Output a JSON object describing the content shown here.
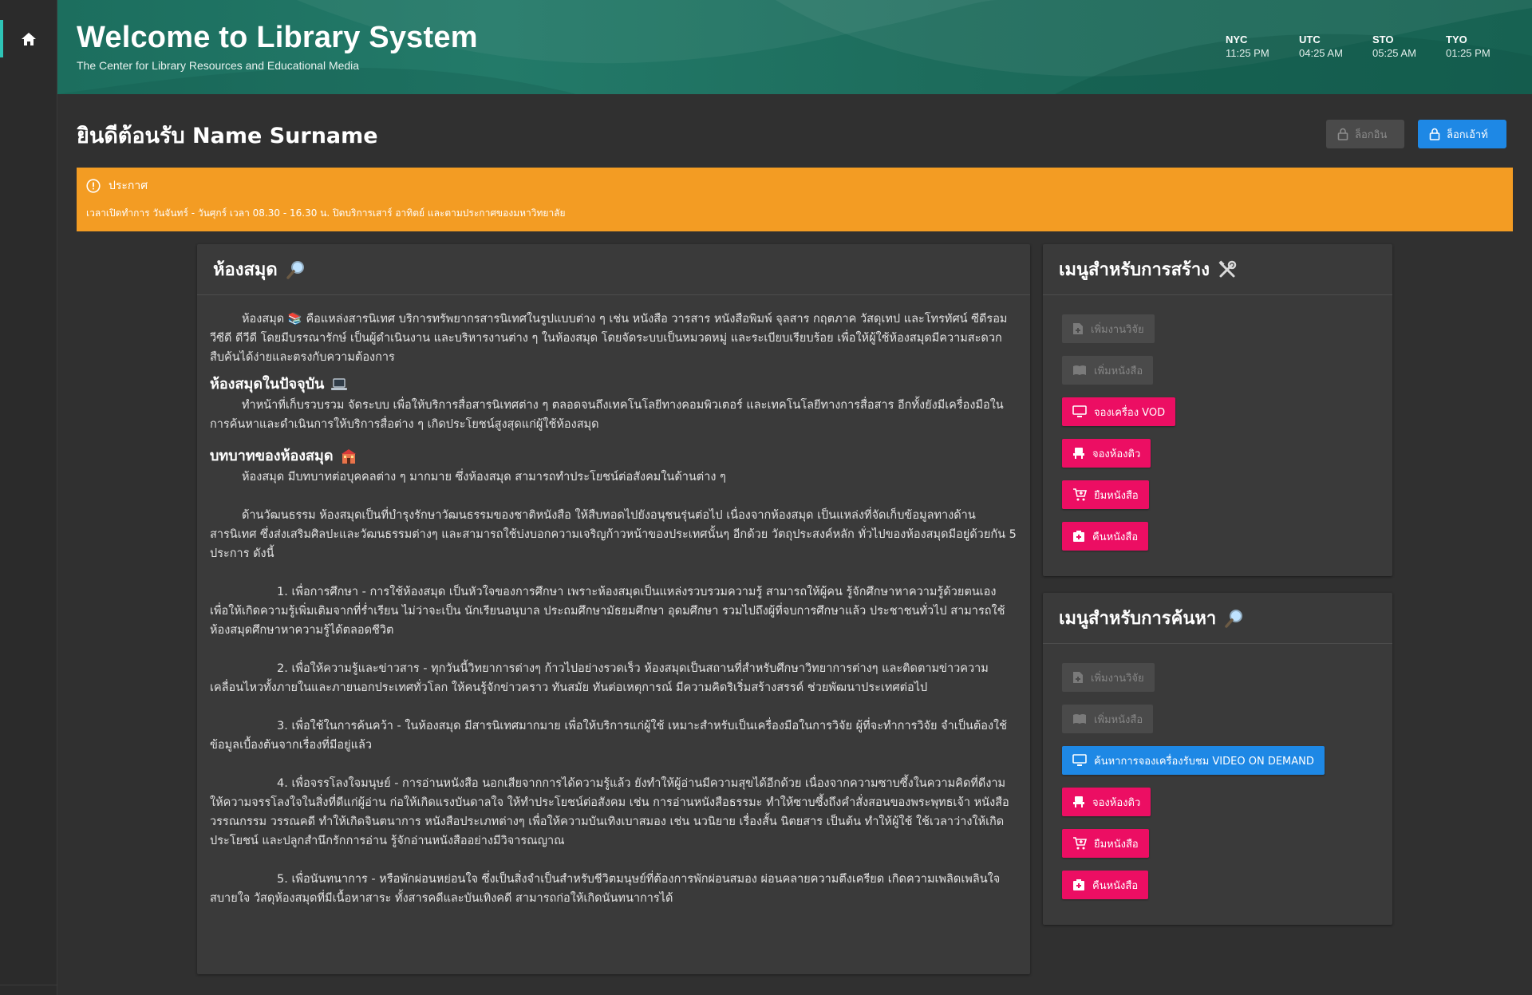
{
  "header": {
    "title": "Welcome to Library System",
    "subtitle": "The Center for Library Resources and Educational Media",
    "clocks": [
      {
        "city": "NYC",
        "time": "11:25 PM"
      },
      {
        "city": "UTC",
        "time": "04:25 AM"
      },
      {
        "city": "STO",
        "time": "05:25 AM"
      },
      {
        "city": "TYO",
        "time": "01:25 PM"
      }
    ]
  },
  "welcome": {
    "text": "ยินดีต้อนรับ Name Surname",
    "login_label": "ล็อกอิน",
    "logout_label": "ล็อกเอ้าท์"
  },
  "notice": {
    "title": "ประกาศ",
    "body": "เวลาเปิดทำการ วันจันทร์ - วันศุกร์ เวลา 08.30 - 16.30 น. ปิดบริการเสาร์ อาทิตย์ และตามประกาศของมหาวิทยาลัย"
  },
  "library": {
    "title": "ห้องสมุด",
    "intro": "ห้องสมุด 📚 คือแหล่งสารนิเทศ บริการทรัพยากรสารนิเทศในรูปแบบต่าง ๆ เช่น หนังสือ วารสาร หนังสือพิมพ์ จุลสาร กฤตภาค วัสดุเทป และโทรทัศน์ ซีดีรอม วีซีดี ดีวีดี โดยมีบรรณารักษ์ เป็นผู้ดำเนินงาน และบริหารงานต่าง ๆ ในห้องสมุด โดยจัดระบบเป็นหมวดหมู่ และระเบียบเรียบร้อย เพื่อให้ผู้ใช้ห้องสมุดมีความสะดวกสืบค้นได้ง่ายและตรงกับความต้องการ",
    "h_today": "ห้องสมุดในปัจจุบัน",
    "today_text": "ทำหน้าที่เก็บรวบรวม จัดระบบ เพื่อให้บริการสื่อสารนิเทศต่าง ๆ ตลอดจนถึงเทคโนโลยีทางคอมพิวเตอร์ และเทคโนโลยีทางการสื่อสาร อีกทั้งยังมีเครื่องมือในการค้นหาและดำเนินการให้บริการสื่อต่าง ๆ เกิดประโยชน์สูงสุดแก่ผู้ใช้ห้องสมุด",
    "h_role": "บทบาทของห้องสมุด",
    "role_text": "ห้องสมุด มีบทบาทต่อบุคคลต่าง ๆ มากมาย ซึ่งห้องสมุด สามารถทำประโยชน์ต่อสังคมในด้านต่าง ๆ",
    "culture_text": "ด้านวัฒนธรรม ห้องสมุดเป็นที่บำรุงรักษาวัฒนธรรมของชาติหนังสือ ให้สืบทอดไปยังอนุชนรุ่นต่อไป เนื่องจากห้องสมุด เป็นแหล่งที่จัดเก็บข้อมูลทางด้านสารนิเทศ ซึ่งส่งเสริมศิลปะและวัฒนธรรมต่างๆ และสามารถใช้บ่งบอกความเจริญก้าวหน้าของประเทศนั้นๆ อีกด้วย วัตถุประสงค์หลัก ทั่วไปของห้องสมุดมีอยู่ด้วยกัน 5 ประการ ดังนี้",
    "items": [
      "1. เพื่อการศึกษา - การใช้ห้องสมุด เป็นหัวใจของการศึกษา เพราะห้องสมุดเป็นแหล่งรวบรวมความรู้ สามารถให้ผู้คน รู้จักศึกษาหาความรู้ด้วยตนเอง เพื่อให้เกิดความรู้เพิ่มเติมจากที่ร่ำเรียน ไม่ว่าจะเป็น นักเรียนอนุบาล ประถมศึกษามัธยมศึกษา อุดมศึกษา รวมไปถึงผู้ที่จบการศึกษาแล้ว ประชาชนทั่วไป สามารถใช้ห้องสมุดศึกษาหาความรู้ได้ตลอดชีวิต",
      "2. เพื่อให้ความรู้และข่าวสาร - ทุกวันนี้วิทยาการต่างๆ ก้าวไปอย่างรวดเร็ว ห้องสมุดเป็นสถานที่สำหรับศึกษาวิทยาการต่างๆ และติดตามข่าวความเคลื่อนไหวทั้งภายในและภายนอกประเทศทั่วโลก ให้คนรู้จักข่าวคราว ทันสมัย ทันต่อเหตุการณ์ มีความคิดริเริ่มสร้างสรรค์ ช่วยพัฒนาประเทศต่อไป",
      "3. เพื่อใช้ในการค้นคว้า - ในห้องสมุด มีสารนิเทศมากมาย เพื่อให้บริการแก่ผู้ใช้ เหมาะสำหรับเป็นเครื่องมือในการวิจัย ผู้ที่จะทำการวิจัย จำเป็นต้องใช้ข้อมูลเบื้องต้นจากเรื่องที่มีอยู่แล้ว",
      "4. เพื่อจรรโลงใจมนุษย์ - การอ่านหนังสือ นอกเสียจากการได้ความรู้แล้ว ยังทำให้ผู้อ่านมีความสุขได้อีกด้วย เนื่องจากความซาบซึ้งในความคิดที่ดีงาม ให้ความจรรโลงใจในสิ่งที่ดีแก่ผู้อ่าน ก่อให้เกิดแรงบันดาลใจ ให้ทำประโยชน์ต่อสังคม เช่น การอ่านหนังสือธรรมะ ทำให้ซาบซึ้งถึงคำสั่งสอนของพระพุทธเจ้า หนังสือวรรณกรรม วรรณคดี ทำให้เกิดจินตนาการ หนังสือประเภทต่างๆ เพื่อให้ความบันเทิงเบาสมอง เช่น นวนิยาย เรื่องสั้น นิตยสาร เป็นต้น ทำให้ผู้ใช้ ใช้เวลาว่างให้เกิดประโยชน์ และปลูกสำนึกรักการอ่าน รู้จักอ่านหนังสืออย่างมีวิจารณญาณ",
      "5. เพื่อนันทนาการ - หรือพักผ่อนหย่อนใจ ซึ่งเป็นสิ่งจำเป็นสำหรับชีวิตมนุษย์ที่ต้องการพักผ่อนสมอง ผ่อนคลายความตึงเครียด เกิดความเพลิดเพลินใจ สบายใจ วัสดุห้องสมุดที่มีเนื้อหาสาระ ทั้งสารคดีและบันเทิงคดี สามารถก่อให้เกิดนันทนาการได้"
    ]
  },
  "create_menu": {
    "title": "เมนูสำหรับการสร้าง",
    "buttons": [
      {
        "label": "เพิ่มงานวิจัย",
        "icon": "document-add-icon"
      },
      {
        "label": "เพิ่มหนังสือ",
        "icon": "book-open-icon"
      },
      {
        "label": "จองเครื่อง VOD",
        "icon": "monitor-icon"
      },
      {
        "label": "จองห้องติว",
        "icon": "chair-icon"
      },
      {
        "label": "ยืมหนังสือ",
        "icon": "cart-add-icon"
      },
      {
        "label": "คืนหนังสือ",
        "icon": "return-box-icon"
      }
    ]
  },
  "search_menu": {
    "title": "เมนูสำหรับการค้นหา",
    "buttons": [
      {
        "label": "เพิ่มงานวิจัย",
        "icon": "document-add-icon"
      },
      {
        "label": "เพิ่มหนังสือ",
        "icon": "book-open-icon"
      },
      {
        "label": "ค้นหาการจองเครื่องรับชม VIDEO ON DEMAND",
        "icon": "monitor-icon"
      },
      {
        "label": "จองห้องติว",
        "icon": "chair-icon"
      },
      {
        "label": "ยืมหนังสือ",
        "icon": "cart-add-icon"
      },
      {
        "label": "คืนหนังสือ",
        "icon": "return-box-icon"
      }
    ]
  },
  "colors": {
    "header": "#1d6c5c",
    "notice": "#f39c23",
    "primary": "#1e88e5",
    "accent": "#ec0e63",
    "card": "#3a3a3a",
    "background": "#303030"
  }
}
